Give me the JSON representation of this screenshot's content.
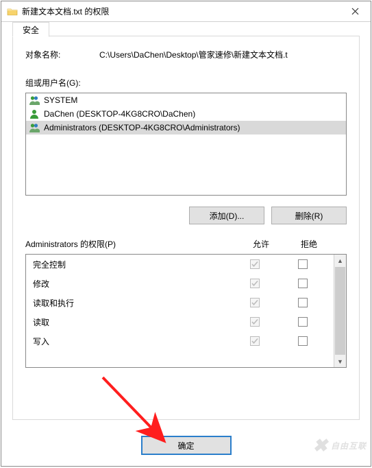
{
  "title": "新建文本文档.txt 的权限",
  "tab": "安全",
  "object_name_label": "对象名称:",
  "object_name_value": "C:\\Users\\DaChen\\Desktop\\管家速修\\新建文本文档.t",
  "groups_label": "组或用户名(G):",
  "principals": [
    {
      "name": "SYSTEM",
      "type": "group",
      "selected": false
    },
    {
      "name": "DaChen (DESKTOP-4KG8CRO\\DaChen)",
      "type": "user",
      "selected": false
    },
    {
      "name": "Administrators (DESKTOP-4KG8CRO\\Administrators)",
      "type": "group",
      "selected": true
    }
  ],
  "add_button": "添加(D)...",
  "remove_button": "删除(R)",
  "perm_header_label": "Administrators 的权限(P)",
  "perm_allow": "允许",
  "perm_deny": "拒绝",
  "permissions": [
    {
      "name": "完全控制",
      "allow": true,
      "deny": false
    },
    {
      "name": "修改",
      "allow": true,
      "deny": false
    },
    {
      "name": "读取和执行",
      "allow": true,
      "deny": false
    },
    {
      "name": "读取",
      "allow": true,
      "deny": false
    },
    {
      "name": "写入",
      "allow": true,
      "deny": false
    }
  ],
  "ok_button": "确定",
  "watermark": "自由互联"
}
